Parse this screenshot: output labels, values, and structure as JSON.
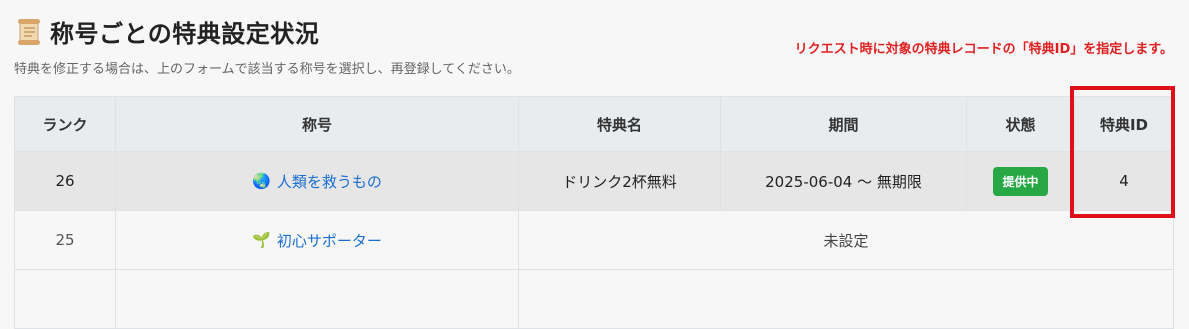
{
  "header": {
    "icon": "scroll-icon",
    "title": "称号ごとの特典設定状況",
    "subtitle": "特典を修正する場合は、上のフォームで該当する称号を選択し、再登録してください。"
  },
  "annotation": {
    "text": "リクエスト時に対象の特典レコードの「特典ID」を指定します。",
    "color": "#e0101a"
  },
  "table": {
    "columns": [
      "ランク",
      "称号",
      "特典名",
      "期間",
      "状態",
      "特典ID"
    ],
    "rows": [
      {
        "rank": "26",
        "title_icon": "🌏",
        "title": "人類を救うもの",
        "benefit": "ドリンク2杯無料",
        "period": "2025-06-04 〜 無期限",
        "status": "提供中",
        "benefit_id": "4"
      },
      {
        "rank": "25",
        "title_icon": "🌱",
        "title": "初心サポーター",
        "unset": "未設定"
      }
    ]
  },
  "colors": {
    "status_active": "#28a745",
    "link": "#1a6fd1",
    "annotation": "#e02020"
  }
}
